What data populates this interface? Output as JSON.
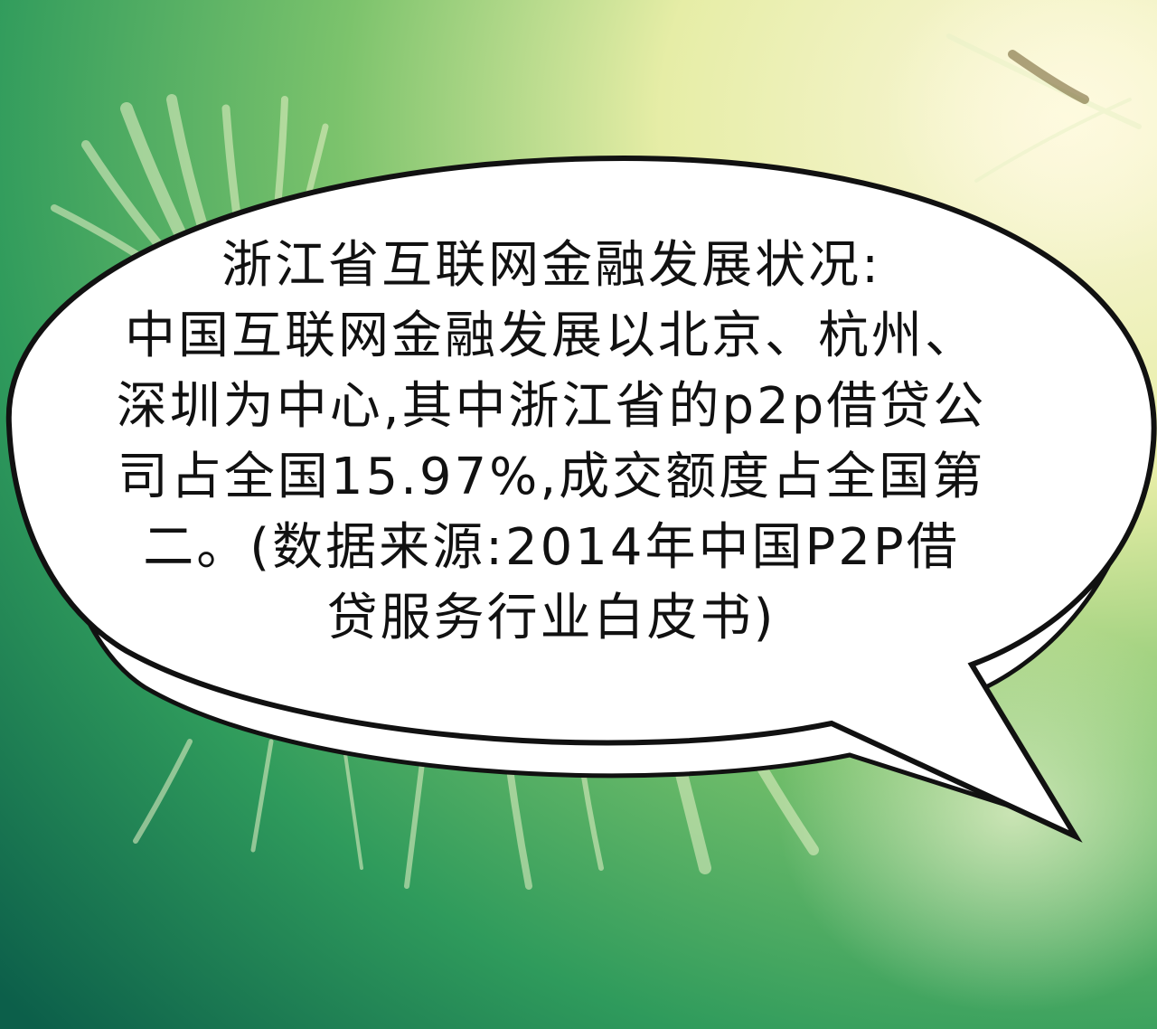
{
  "caption": {
    "lines": [
      "浙江省互联网金融发展状况:",
      "中国互联网金融发展以北京、杭州、",
      "深圳为中心,其中浙江省的p2p借贷公",
      "司占全国15.97%,成交额度占全国第",
      "二。(数据来源:2014年中国P2P借",
      "贷服务行业白皮书)"
    ]
  },
  "colors": {
    "background_dark": "#0f6e50",
    "background_mid": "#4caf66",
    "background_light": "#f3f2cf",
    "bubble_fill": "#ffffff",
    "bubble_outline": "#111111"
  }
}
